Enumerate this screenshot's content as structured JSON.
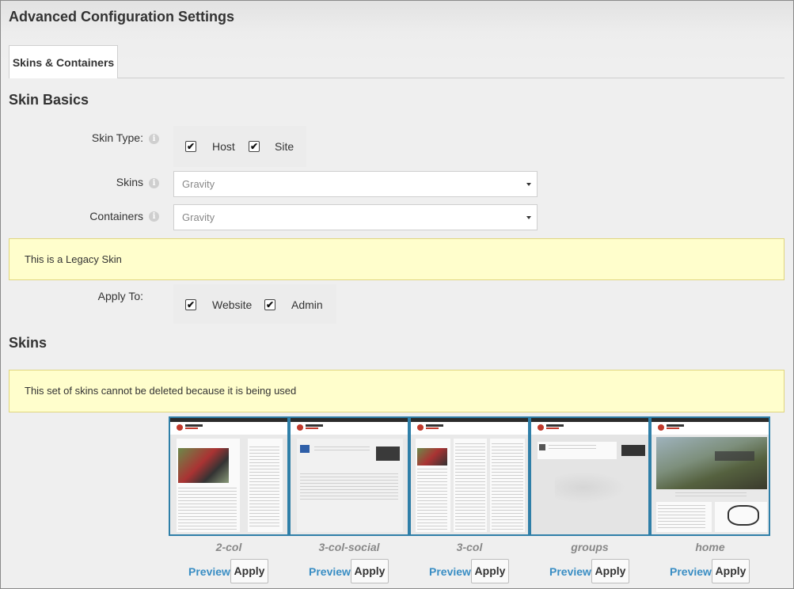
{
  "page_title": "Advanced Configuration Settings",
  "tabs": [
    {
      "label": "Skins & Containers",
      "active": true
    }
  ],
  "skin_basics": {
    "heading": "Skin Basics",
    "skin_type": {
      "label": "Skin Type:",
      "options": [
        {
          "label": "Host",
          "checked": true
        },
        {
          "label": "Site",
          "checked": true
        }
      ]
    },
    "skins": {
      "label": "Skins",
      "value": "Gravity"
    },
    "containers": {
      "label": "Containers",
      "value": "Gravity"
    },
    "legacy_notice": "This is a Legacy Skin",
    "apply_to": {
      "label": "Apply To:",
      "options": [
        {
          "label": "Website",
          "checked": true
        },
        {
          "label": "Admin",
          "checked": true
        }
      ]
    }
  },
  "skins_section": {
    "heading": "Skins",
    "notice": "This set of skins cannot be deleted because it is being used",
    "items": [
      {
        "name": "2-col",
        "preview_label": "Preview",
        "apply_label": "Apply"
      },
      {
        "name": "3-col-social",
        "preview_label": "Preview",
        "apply_label": "Apply"
      },
      {
        "name": "3-col",
        "preview_label": "Preview",
        "apply_label": "Apply"
      },
      {
        "name": "groups",
        "preview_label": "Preview",
        "apply_label": "Apply"
      },
      {
        "name": "home",
        "preview_label": "Preview",
        "apply_label": "Apply"
      }
    ]
  },
  "icons": {
    "info": "info-icon",
    "check": "checkmark-icon",
    "caret": "caret-down-icon"
  },
  "colors": {
    "accent": "#3a8ec4",
    "thumb_border": "#2f7fa8",
    "notice_bg": "#fffecc",
    "notice_border": "#e1d67e"
  }
}
